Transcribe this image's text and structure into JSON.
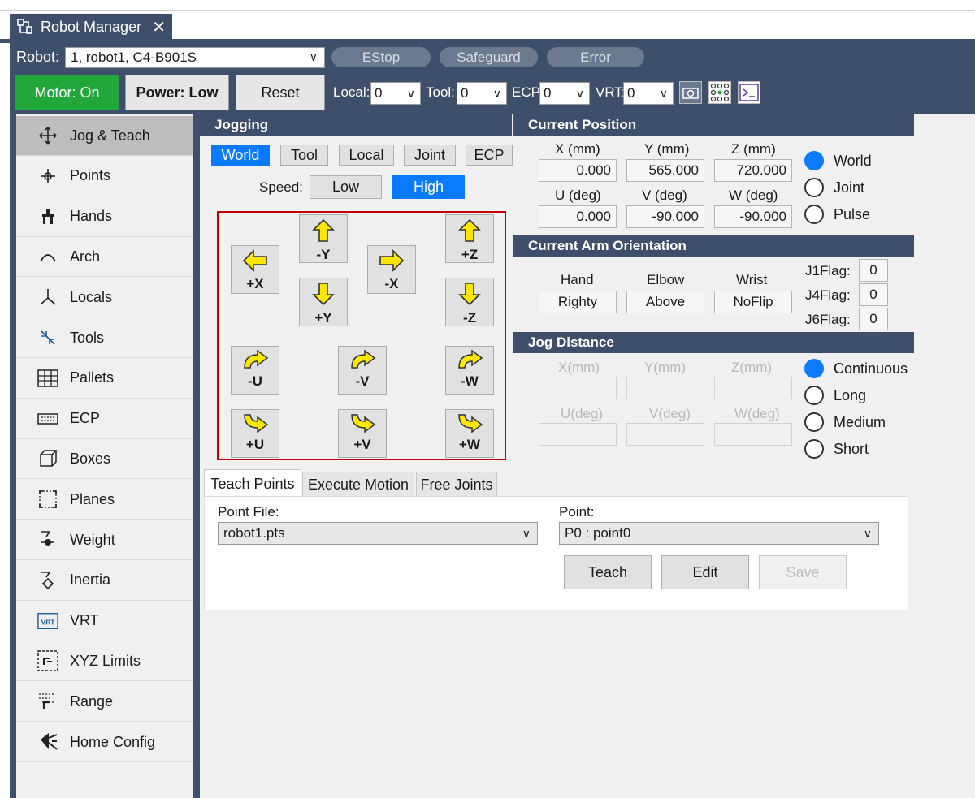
{
  "tab": {
    "title": "Robot Manager",
    "close": "✕"
  },
  "header": {
    "robot_label": "Robot:",
    "robot_value": "1, robot1, C4-B901S",
    "estop": "EStop",
    "safeguard": "Safeguard",
    "error": "Error",
    "motor": "Motor: On",
    "power": "Power: Low",
    "reset": "Reset",
    "local_label": "Local:",
    "local_value": "0",
    "tool_label": "Tool:",
    "tool_value": "0",
    "ecp_label": "ECP:",
    "ecp_value": "0",
    "vrt_label": "VRT:",
    "vrt_value": "0",
    "colors": {
      "header": "#3d4f6b",
      "motor_on": "#22a83a",
      "selected": "#0a7aff"
    }
  },
  "sidebar": {
    "items": [
      {
        "label": "Jog & Teach",
        "icon": "move-arrows-icon"
      },
      {
        "label": "Points",
        "icon": "points-icon"
      },
      {
        "label": "Hands",
        "icon": "hand-icon"
      },
      {
        "label": "Arch",
        "icon": "arch-icon"
      },
      {
        "label": "Locals",
        "icon": "axes-icon"
      },
      {
        "label": "Tools",
        "icon": "tool-icon"
      },
      {
        "label": "Pallets",
        "icon": "grid-icon"
      },
      {
        "label": "ECP",
        "icon": "keyboard-icon"
      },
      {
        "label": "Boxes",
        "icon": "box-icon"
      },
      {
        "label": "Planes",
        "icon": "plane-icon"
      },
      {
        "label": "Weight",
        "icon": "weight-icon"
      },
      {
        "label": "Inertia",
        "icon": "inertia-icon"
      },
      {
        "label": "VRT",
        "icon": "vrt-icon"
      },
      {
        "label": "XYZ Limits",
        "icon": "xyz-limits-icon"
      },
      {
        "label": "Range",
        "icon": "range-icon"
      },
      {
        "label": "Home Config",
        "icon": "home-config-icon"
      }
    ]
  },
  "jogging": {
    "title": "Jogging",
    "modes": [
      "World",
      "Tool",
      "Local",
      "Joint",
      "ECP"
    ],
    "speed_label": "Speed:",
    "speed_low": "Low",
    "speed_high": "High",
    "buttons": {
      "mY": "-Y",
      "pZ": "+Z",
      "pX": "+X",
      "mX": "-X",
      "pY": "+Y",
      "mZ": "-Z",
      "mU": "-U",
      "mV": "-V",
      "mW": "-W",
      "pU": "+U",
      "pV": "+V",
      "pW": "+W"
    }
  },
  "position": {
    "title": "Current Position",
    "x_label": "X (mm)",
    "y_label": "Y (mm)",
    "z_label": "Z (mm)",
    "u_label": "U (deg)",
    "v_label": "V (deg)",
    "w_label": "W (deg)",
    "x": "0.000",
    "y": "565.000",
    "z": "720.000",
    "u": "0.000",
    "v": "-90.000",
    "w": "-90.000",
    "radio": [
      "World",
      "Joint",
      "Pulse"
    ]
  },
  "orientation": {
    "title": "Current Arm Orientation",
    "hand_label": "Hand",
    "elbow_label": "Elbow",
    "wrist_label": "Wrist",
    "hand": "Righty",
    "elbow": "Above",
    "wrist": "NoFlip",
    "j1_label": "J1Flag:",
    "j4_label": "J4Flag:",
    "j6_label": "J6Flag:",
    "j1": "0",
    "j4": "0",
    "j6": "0"
  },
  "distance": {
    "title": "Jog Distance",
    "x_label": "X(mm)",
    "y_label": "Y(mm)",
    "z_label": "Z(mm)",
    "u_label": "U(deg)",
    "v_label": "V(deg)",
    "w_label": "W(deg)",
    "radio": [
      "Continuous",
      "Long",
      "Medium",
      "Short"
    ]
  },
  "teach": {
    "tabs": [
      "Teach Points",
      "Execute Motion",
      "Free Joints"
    ],
    "point_file_label": "Point File:",
    "point_file": "robot1.pts",
    "point_label": "Point:",
    "point": "P0 : point0",
    "teach_btn": "Teach",
    "edit_btn": "Edit",
    "save_btn": "Save"
  }
}
